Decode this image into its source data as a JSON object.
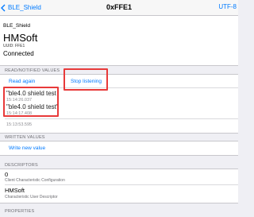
{
  "navbar": {
    "back_label": "BLE_Shield",
    "title": "0xFFE1",
    "right_label": "UTF-8"
  },
  "device": {
    "name": "BLE_Shield",
    "title": "HMSoft",
    "uuid": "UUID: FFE1",
    "status": "Connected"
  },
  "read_section": {
    "header": "READ/NOTIFIED VALUES",
    "read_again": "Read again",
    "stop_listening": "Stop listening",
    "values": [
      {
        "text": "\"ble4.0 shield test",
        "time": "15:14:26.037"
      },
      {
        "text": "\"ble4.0 shield test\"",
        "time": "15:14:17.408"
      },
      {
        "text": "",
        "time": "15:13:53.595"
      }
    ]
  },
  "written_section": {
    "header": "WRITTEN VALUES",
    "write_new": "Write new value"
  },
  "descriptors_section": {
    "header": "DESCRIPTORS",
    "items": [
      {
        "value": "0",
        "label": "Client Characteristic Configuration"
      },
      {
        "value": "HMSoft",
        "label": "Characteristic User Descriptor"
      }
    ]
  },
  "properties_section": {
    "header": "PROPERTIES"
  },
  "highlight_color": "#e83a3a",
  "accent_color": "#007aff"
}
